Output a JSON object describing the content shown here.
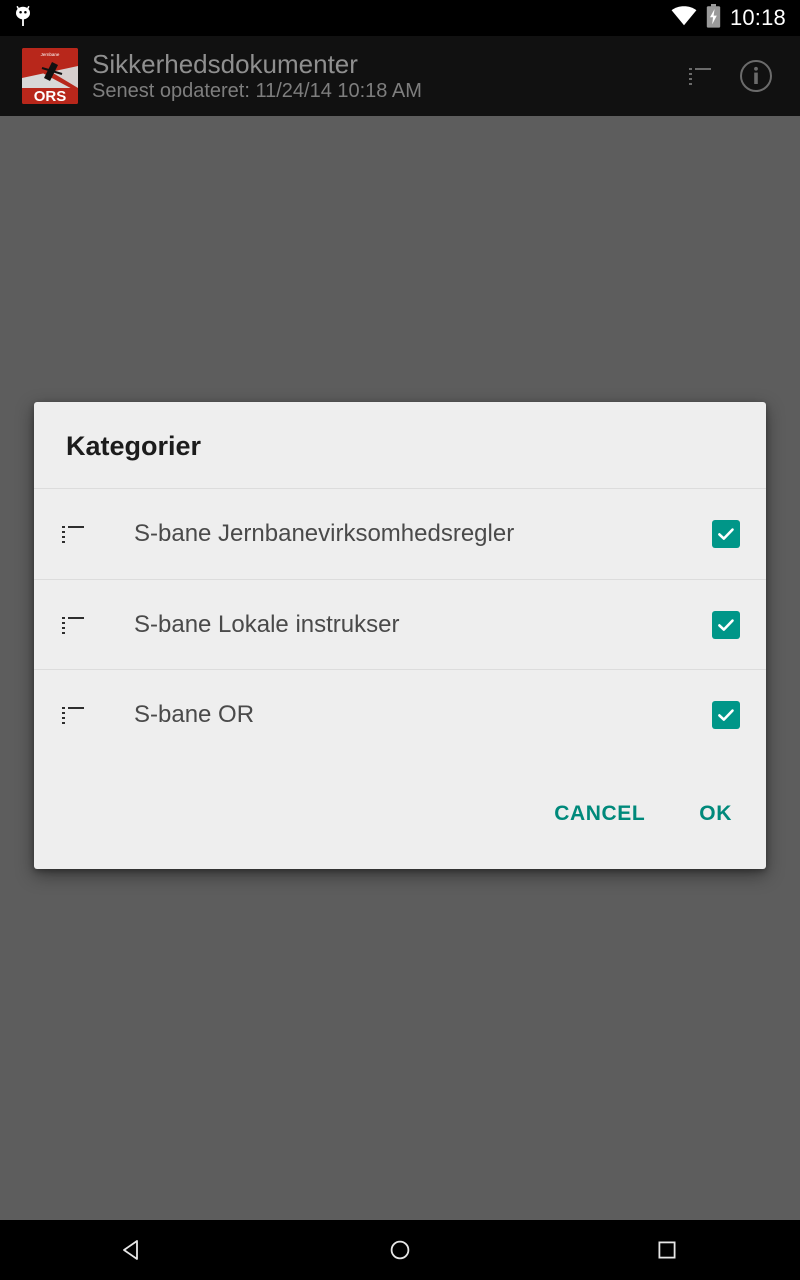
{
  "status_bar": {
    "notification_icon": "android-bug-icon",
    "wifi_icon": "wifi-icon",
    "battery_icon": "battery-charging-icon",
    "clock": "10:18"
  },
  "action_bar": {
    "logo": "ors-app-logo",
    "logo_text": "ORS",
    "title": "Sikkerhedsdokumenter",
    "subtitle": "Senest opdateret: 11/24/14 10:18 AM",
    "actions": [
      {
        "name": "list-icon",
        "label": "Liste"
      },
      {
        "name": "info-icon",
        "label": "Info"
      }
    ]
  },
  "dialog": {
    "title": "Kategorier",
    "rows": [
      {
        "handle_icon": "drag-handle-icon",
        "label": "S-bane Jernbanevirksomhedsregler",
        "checked": true
      },
      {
        "handle_icon": "drag-handle-icon",
        "label": "S-bane Lokale instrukser",
        "checked": true
      },
      {
        "handle_icon": "drag-handle-icon",
        "label": "S-bane OR",
        "checked": true
      }
    ],
    "cancel_label": "CANCEL",
    "ok_label": "OK"
  },
  "nav_bar": {
    "back": "back-icon",
    "home": "home-icon",
    "recents": "recents-icon"
  },
  "colors": {
    "accent": "#009688",
    "button_text": "#00897b",
    "dialog_bg": "#eeeeee",
    "scrim": "#5d5d5d",
    "action_bar_bg": "#111111",
    "logo_red": "#c0392b"
  }
}
